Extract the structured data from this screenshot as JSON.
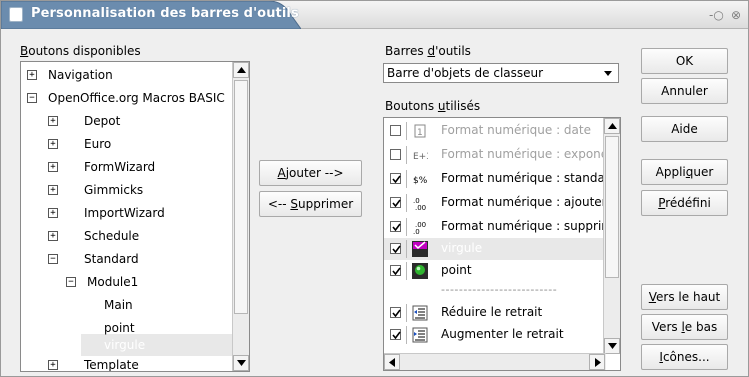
{
  "window": {
    "title": "Personnalisation des barres d'outils",
    "controls": [
      "-○",
      "⊗"
    ]
  },
  "available": {
    "label_u": "B",
    "label_rest": "outons disponibles",
    "tree": [
      {
        "label": "Navigation",
        "expander": "+"
      },
      {
        "label": "OpenOffice.org Macros BASIC",
        "expander": "−"
      },
      {
        "label": "Depot",
        "expander": "+"
      },
      {
        "label": "Euro",
        "expander": "+"
      },
      {
        "label": "FormWizard",
        "expander": "+"
      },
      {
        "label": "Gimmicks",
        "expander": "+"
      },
      {
        "label": "ImportWizard",
        "expander": "+"
      },
      {
        "label": "Schedule",
        "expander": "+"
      },
      {
        "label": "Standard",
        "expander": "−"
      },
      {
        "label": "Module1",
        "expander": "−"
      },
      {
        "label": "Main"
      },
      {
        "label": "point"
      },
      {
        "label": "virgule"
      },
      {
        "label": "Template",
        "expander": "+"
      }
    ]
  },
  "middle": {
    "add_u": "A",
    "add_rest": "jouter -->",
    "remove_pre": "<-- ",
    "remove_u": "S",
    "remove_rest": "upprimer"
  },
  "toolbars": {
    "label_pre": "Barres ",
    "label_u": "d",
    "label_rest": "'outils",
    "selected": "Barre d'objets de classeur"
  },
  "used": {
    "label_pre": "Boutons ",
    "label_u": "u",
    "label_rest": "tilisés",
    "items": [
      {
        "label": "Format numérique : date",
        "checked": false,
        "disabled": true,
        "icon": "date-format-icon"
      },
      {
        "label": "Format numérique : expone",
        "checked": false,
        "disabled": true,
        "icon": "exponent-format-icon"
      },
      {
        "label": "Format numérique : standar",
        "checked": true,
        "disabled": false,
        "icon": "standard-format-icon"
      },
      {
        "label": "Format numérique : ajouter",
        "checked": true,
        "disabled": false,
        "icon": "add-decimal-icon"
      },
      {
        "label": "Format numérique : supprim",
        "checked": true,
        "disabled": false,
        "icon": "delete-decimal-icon"
      },
      {
        "label": "virgule",
        "checked": true,
        "disabled": false,
        "selected": true,
        "icon": "macro-virgule-icon"
      },
      {
        "label": "point",
        "checked": true,
        "disabled": false,
        "icon": "macro-point-icon"
      },
      {
        "label": "Réduire le retrait",
        "checked": true,
        "disabled": false,
        "icon": "decrease-indent-icon"
      },
      {
        "label": "Augmenter le retrait",
        "checked": true,
        "disabled": false,
        "icon": "increase-indent-icon"
      }
    ],
    "separator": "--------------------------"
  },
  "buttons": {
    "ok": "OK",
    "cancel": "Annuler",
    "help": "Aide",
    "apply_pre": "Appli",
    "apply_u": "q",
    "apply_rest": "uer",
    "default_u": "P",
    "default_rest": "rédéfini",
    "up_u": "V",
    "up_rest": "ers le haut",
    "down_pre": "Vers ",
    "down_u": "l",
    "down_rest": "e bas",
    "icons_u": "I",
    "icons_rest": "cônes..."
  },
  "colors": {
    "title_tab": "#6b8cae",
    "selection": "#e8e8e8",
    "disabled_text": "#a0a0a0"
  }
}
